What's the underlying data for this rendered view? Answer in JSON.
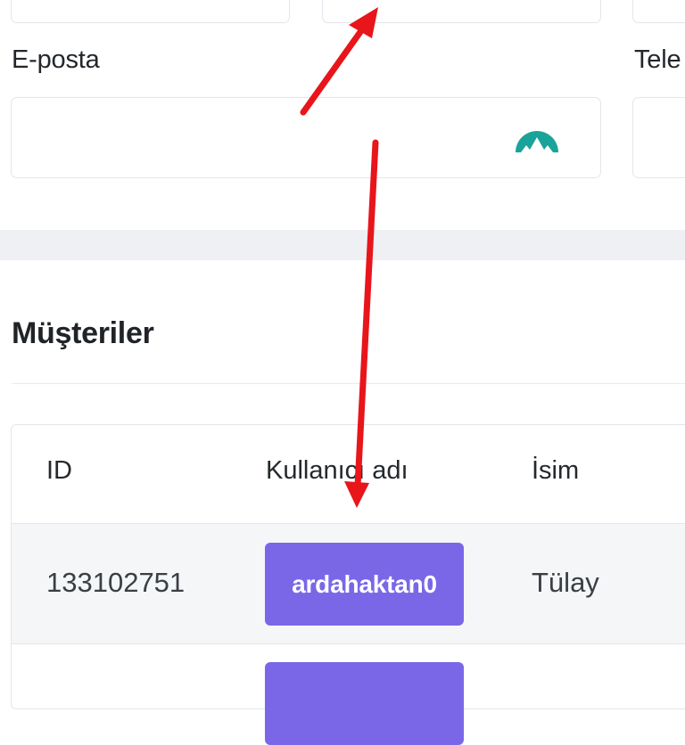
{
  "form": {
    "email_label": "E-posta",
    "phone_label": "Tele",
    "email_value": ""
  },
  "extension": {
    "icon": "mountain-logo-icon",
    "color": "#1aa39a"
  },
  "customers": {
    "title": "Müşteriler",
    "columns": [
      "ID",
      "Kullanıcı adı",
      "İsim"
    ],
    "rows": [
      {
        "id": "133102751",
        "username": "ardahaktan0",
        "name": "Tülay"
      },
      {
        "id": "",
        "username": "",
        "name": ""
      }
    ]
  },
  "colors": {
    "accent": "#7a67e8",
    "annotation": "#e8151b"
  }
}
